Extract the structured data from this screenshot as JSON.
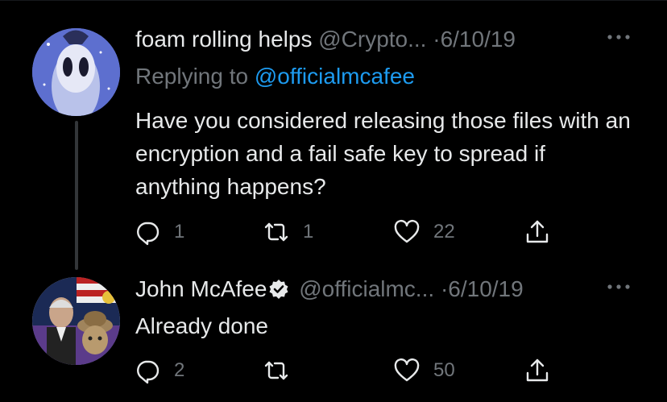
{
  "tweets": [
    {
      "display_name": "foam rolling helps",
      "handle": "@Crypto...",
      "separator": "·",
      "date": "6/10/19",
      "more_icon": "ellipsis-icon",
      "reply_prefix": "Replying to",
      "reply_mention": "@officialmcafee",
      "text": "Have you considered releasing those files with an encryption and a fail safe key to spread if anything happens?",
      "actions": {
        "reply_count": "1",
        "retweet_count": "1",
        "like_count": "22",
        "share_count": ""
      }
    },
    {
      "display_name": "John McAfee",
      "verified": true,
      "handle": "@officialmc...",
      "separator": "·",
      "date": "6/10/19",
      "more_icon": "ellipsis-icon",
      "text": "Already done",
      "actions": {
        "reply_count": "2",
        "retweet_count": "",
        "like_count": "50",
        "share_count": ""
      }
    }
  ],
  "colors": {
    "background": "#000000",
    "text": "#e7e9ea",
    "secondary": "#71767b",
    "accent": "#1d9bf0"
  }
}
